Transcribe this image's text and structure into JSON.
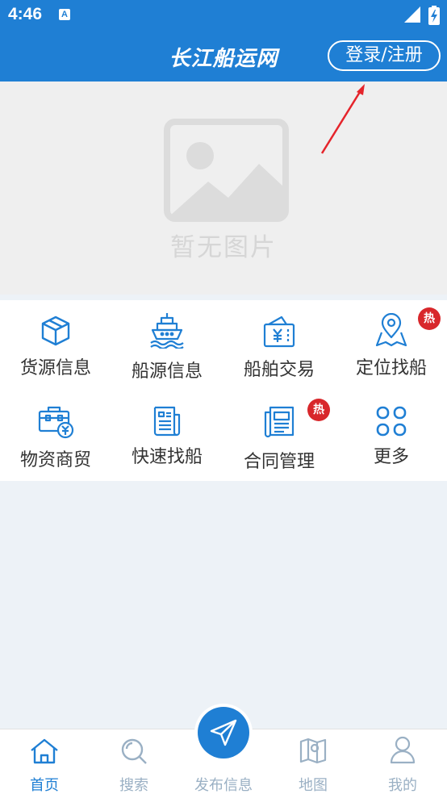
{
  "status_bar": {
    "time": "4:46",
    "notification_icon_text": "A",
    "icons": [
      "signal-icon",
      "battery-charging-icon"
    ]
  },
  "header": {
    "title": "长江船运网",
    "login_label": "登录/注册"
  },
  "banner": {
    "placeholder_text": "暂无图片",
    "icon": "image-placeholder-icon"
  },
  "menu": {
    "badge_text": "热",
    "items": [
      {
        "label": "货源信息",
        "icon": "cargo-box-icon",
        "hot": false
      },
      {
        "label": "船源信息",
        "icon": "ship-icon",
        "hot": false
      },
      {
        "label": "船舶交易",
        "icon": "yen-wallet-icon",
        "hot": false
      },
      {
        "label": "定位找船",
        "icon": "map-pin-icon",
        "hot": true
      },
      {
        "label": "物资商贸",
        "icon": "trade-briefcase-icon",
        "hot": false
      },
      {
        "label": "快速找船",
        "icon": "document-list-icon",
        "hot": false
      },
      {
        "label": "合同管理",
        "icon": "contract-icon",
        "hot": true
      },
      {
        "label": "更多",
        "icon": "grid-more-icon",
        "hot": false
      }
    ]
  },
  "bottom_nav": {
    "items": [
      {
        "label": "首页",
        "icon": "home-icon",
        "active": true
      },
      {
        "label": "搜索",
        "icon": "search-icon",
        "active": false
      },
      {
        "label": "发布信息",
        "icon": "paper-plane-icon",
        "active": false
      },
      {
        "label": "地图",
        "icon": "map-icon",
        "active": false
      },
      {
        "label": "我的",
        "icon": "user-icon",
        "active": false
      }
    ]
  },
  "colors": {
    "primary": "#1f7fd4",
    "hot_badge": "#d8272b",
    "annotation_arrow": "#e5242b",
    "inactive_nav": "#9ab0c4"
  }
}
